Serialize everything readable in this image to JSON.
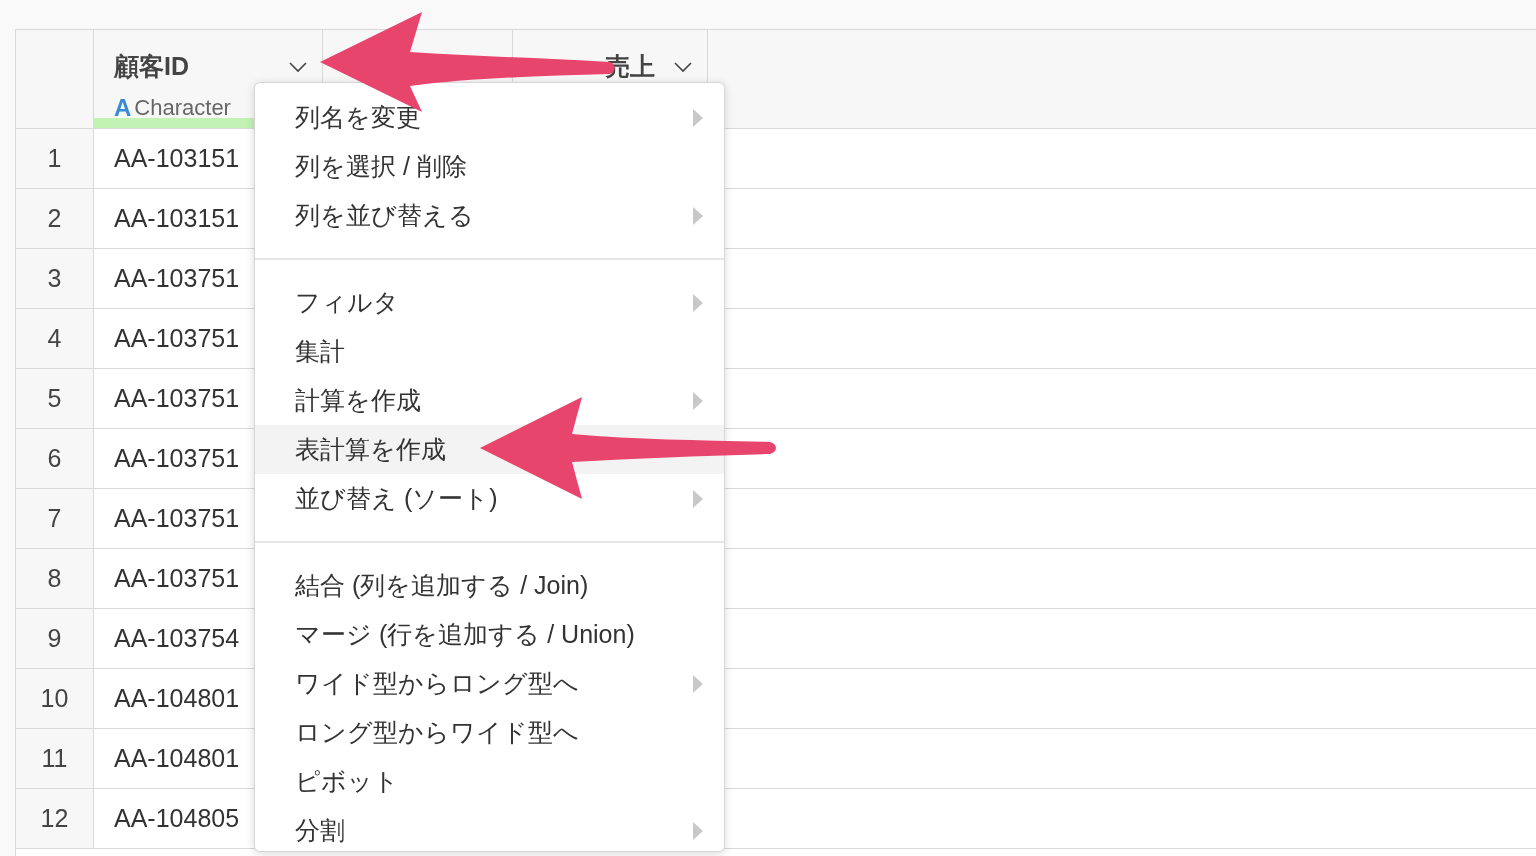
{
  "table": {
    "columns": [
      {
        "name": "顧客ID",
        "type_icon": "A",
        "type": "Character",
        "has_dropdown": true
      },
      {
        "has_dropdown": false
      },
      {
        "name": "売上",
        "has_dropdown": true
      }
    ],
    "rows": [
      {
        "index": "1",
        "customer_id": "AA-103151"
      },
      {
        "index": "2",
        "customer_id": "AA-103151"
      },
      {
        "index": "3",
        "customer_id": "AA-103751"
      },
      {
        "index": "4",
        "customer_id": "AA-103751"
      },
      {
        "index": "5",
        "customer_id": "AA-103751"
      },
      {
        "index": "6",
        "customer_id": "AA-103751"
      },
      {
        "index": "7",
        "customer_id": "AA-103751"
      },
      {
        "index": "8",
        "customer_id": "AA-103751"
      },
      {
        "index": "9",
        "customer_id": "AA-103754"
      },
      {
        "index": "10",
        "customer_id": "AA-104801"
      },
      {
        "index": "11",
        "customer_id": "AA-104801"
      },
      {
        "index": "12",
        "customer_id": "AA-104805"
      }
    ]
  },
  "context_menu": {
    "groups": [
      [
        {
          "label": "列名を変更",
          "has_submenu": true,
          "highlighted": false
        },
        {
          "label": "列を選択 / 削除",
          "has_submenu": false,
          "highlighted": false
        },
        {
          "label": "列を並び替える",
          "has_submenu": true,
          "highlighted": false
        }
      ],
      [
        {
          "label": "フィルタ",
          "has_submenu": true,
          "highlighted": false
        },
        {
          "label": "集計",
          "has_submenu": false,
          "highlighted": false
        },
        {
          "label": "計算を作成",
          "has_submenu": true,
          "highlighted": false
        },
        {
          "label": "表計算を作成",
          "has_submenu": false,
          "highlighted": true
        },
        {
          "label": "並び替え (ソート)",
          "has_submenu": true,
          "highlighted": false
        }
      ],
      [
        {
          "label": "結合 (列を追加する / Join)",
          "has_submenu": false,
          "highlighted": false
        },
        {
          "label": "マージ (行を追加する / Union)",
          "has_submenu": false,
          "highlighted": false
        },
        {
          "label": "ワイド型からロング型へ",
          "has_submenu": true,
          "highlighted": false
        },
        {
          "label": "ロング型からワイド型へ",
          "has_submenu": false,
          "highlighted": false
        },
        {
          "label": "ピボット",
          "has_submenu": false,
          "highlighted": false
        },
        {
          "label": "分割",
          "has_submenu": true,
          "highlighted": false
        }
      ]
    ]
  },
  "annotations": [
    {
      "kind": "arrow"
    },
    {
      "kind": "arrow"
    }
  ]
}
